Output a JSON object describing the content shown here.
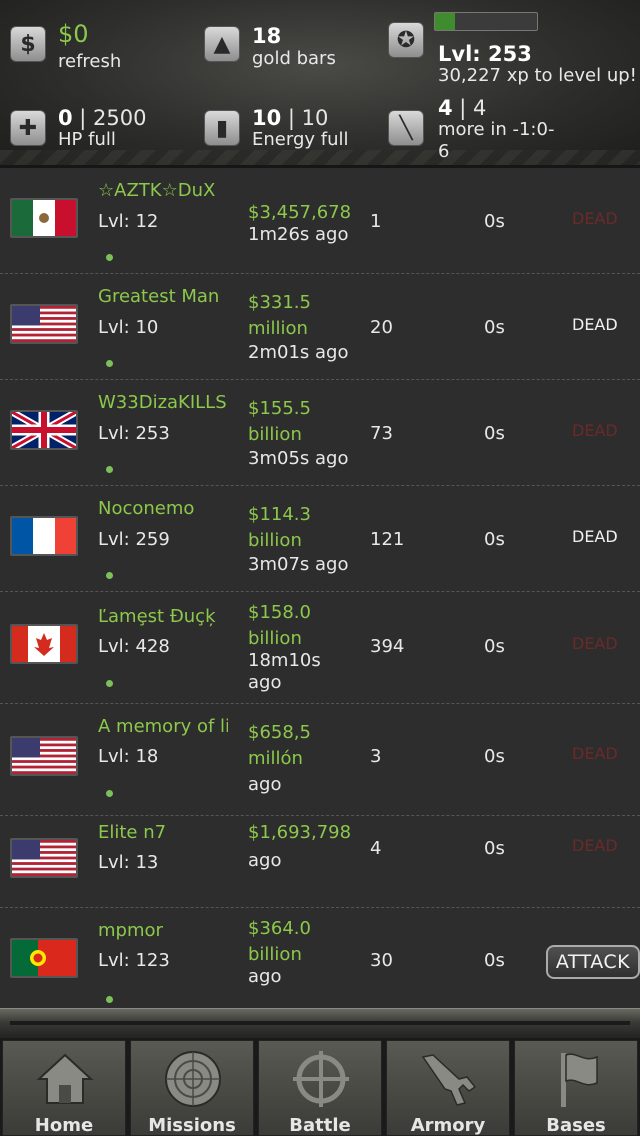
{
  "header": {
    "cash": "$0",
    "cash_sub": "refresh",
    "gold": "18",
    "gold_sub": "gold bars",
    "level": "Lvl: 253",
    "xp_text": "30,227 xp to level up!",
    "xp_progress": 0.2,
    "hp_current": "0",
    "hp_max": " | 2500",
    "hp_sub": "HP full",
    "energy_current": "10",
    "energy_max": " | 10",
    "energy_sub": "Energy full",
    "stamina_current": "4",
    "stamina_max": " | 4",
    "stamina_sub_1": "more in -1:0-",
    "stamina_sub_2": "6",
    "icons": [
      "cash-icon",
      "gold-icon",
      "rank-icon",
      "health-icon",
      "energy-icon",
      "stamina-icon"
    ]
  },
  "players": [
    {
      "name": "☆AZTK☆DuX",
      "level": "Lvl: 12",
      "bounty": [
        "$3,457,678"
      ],
      "ago": [
        "1m26s ago"
      ],
      "kills": "1",
      "timer": "0s",
      "status": "DEAD",
      "status_dim": true,
      "flag": "mexico"
    },
    {
      "name": "Greatest Man",
      "level": "Lvl: 10",
      "bounty": [
        "$331.5",
        "million"
      ],
      "ago": [
        "2m01s ago"
      ],
      "kills": "20",
      "timer": "0s",
      "status": "DEAD",
      "status_dim": false,
      "flag": "usa"
    },
    {
      "name": "W33DizaKILLS",
      "level": "Lvl: 253",
      "bounty": [
        "$155.5",
        "billion"
      ],
      "ago": [
        "3m05s ago"
      ],
      "kills": "73",
      "timer": "0s",
      "status": "DEAD",
      "status_dim": true,
      "flag": "uk"
    },
    {
      "name": "Noconemo",
      "level": "Lvl: 259",
      "bounty": [
        "$114.3",
        "billion"
      ],
      "ago": [
        "3m07s ago"
      ],
      "kills": "121",
      "timer": "0s",
      "status": "DEAD",
      "status_dim": false,
      "flag": "france"
    },
    {
      "name": "Ľamȩst Đuçķ",
      "level": "Lvl: 428",
      "bounty": [
        "$158.0",
        "billion"
      ],
      "ago": [
        "18m10s",
        "ago"
      ],
      "kills": "394",
      "timer": "0s",
      "status": "DEAD",
      "status_dim": true,
      "flag": "canada"
    },
    {
      "name": "A memory of li",
      "level": "Lvl: 18",
      "bounty": [
        "$658,5",
        "millón"
      ],
      "ago": [
        "ago"
      ],
      "kills": "3",
      "timer": "0s",
      "status": "DEAD",
      "status_dim": true,
      "flag": "usa"
    },
    {
      "name": "Elite n7",
      "level": "Lvl: 13",
      "bounty": [
        "$1,693,798"
      ],
      "ago": [
        "ago"
      ],
      "kills": "4",
      "timer": "0s",
      "status": "DEAD",
      "status_dim": true,
      "flag": "usa"
    },
    {
      "name": "mpmor",
      "level": "Lvl: 123",
      "bounty": [
        "$364.0",
        "billion"
      ],
      "ago": [
        "ago"
      ],
      "kills": "30",
      "timer": "0s",
      "status": "ATTACK",
      "status_dim": false,
      "flag": "portugal"
    }
  ],
  "tabs": [
    {
      "label": "Home",
      "icon": "home-icon"
    },
    {
      "label": "Missions",
      "icon": "radar-icon"
    },
    {
      "label": "Battle",
      "icon": "crosshair-icon"
    },
    {
      "label": "Armory",
      "icon": "rifle-icon"
    },
    {
      "label": "Bases",
      "icon": "flag-icon"
    }
  ]
}
